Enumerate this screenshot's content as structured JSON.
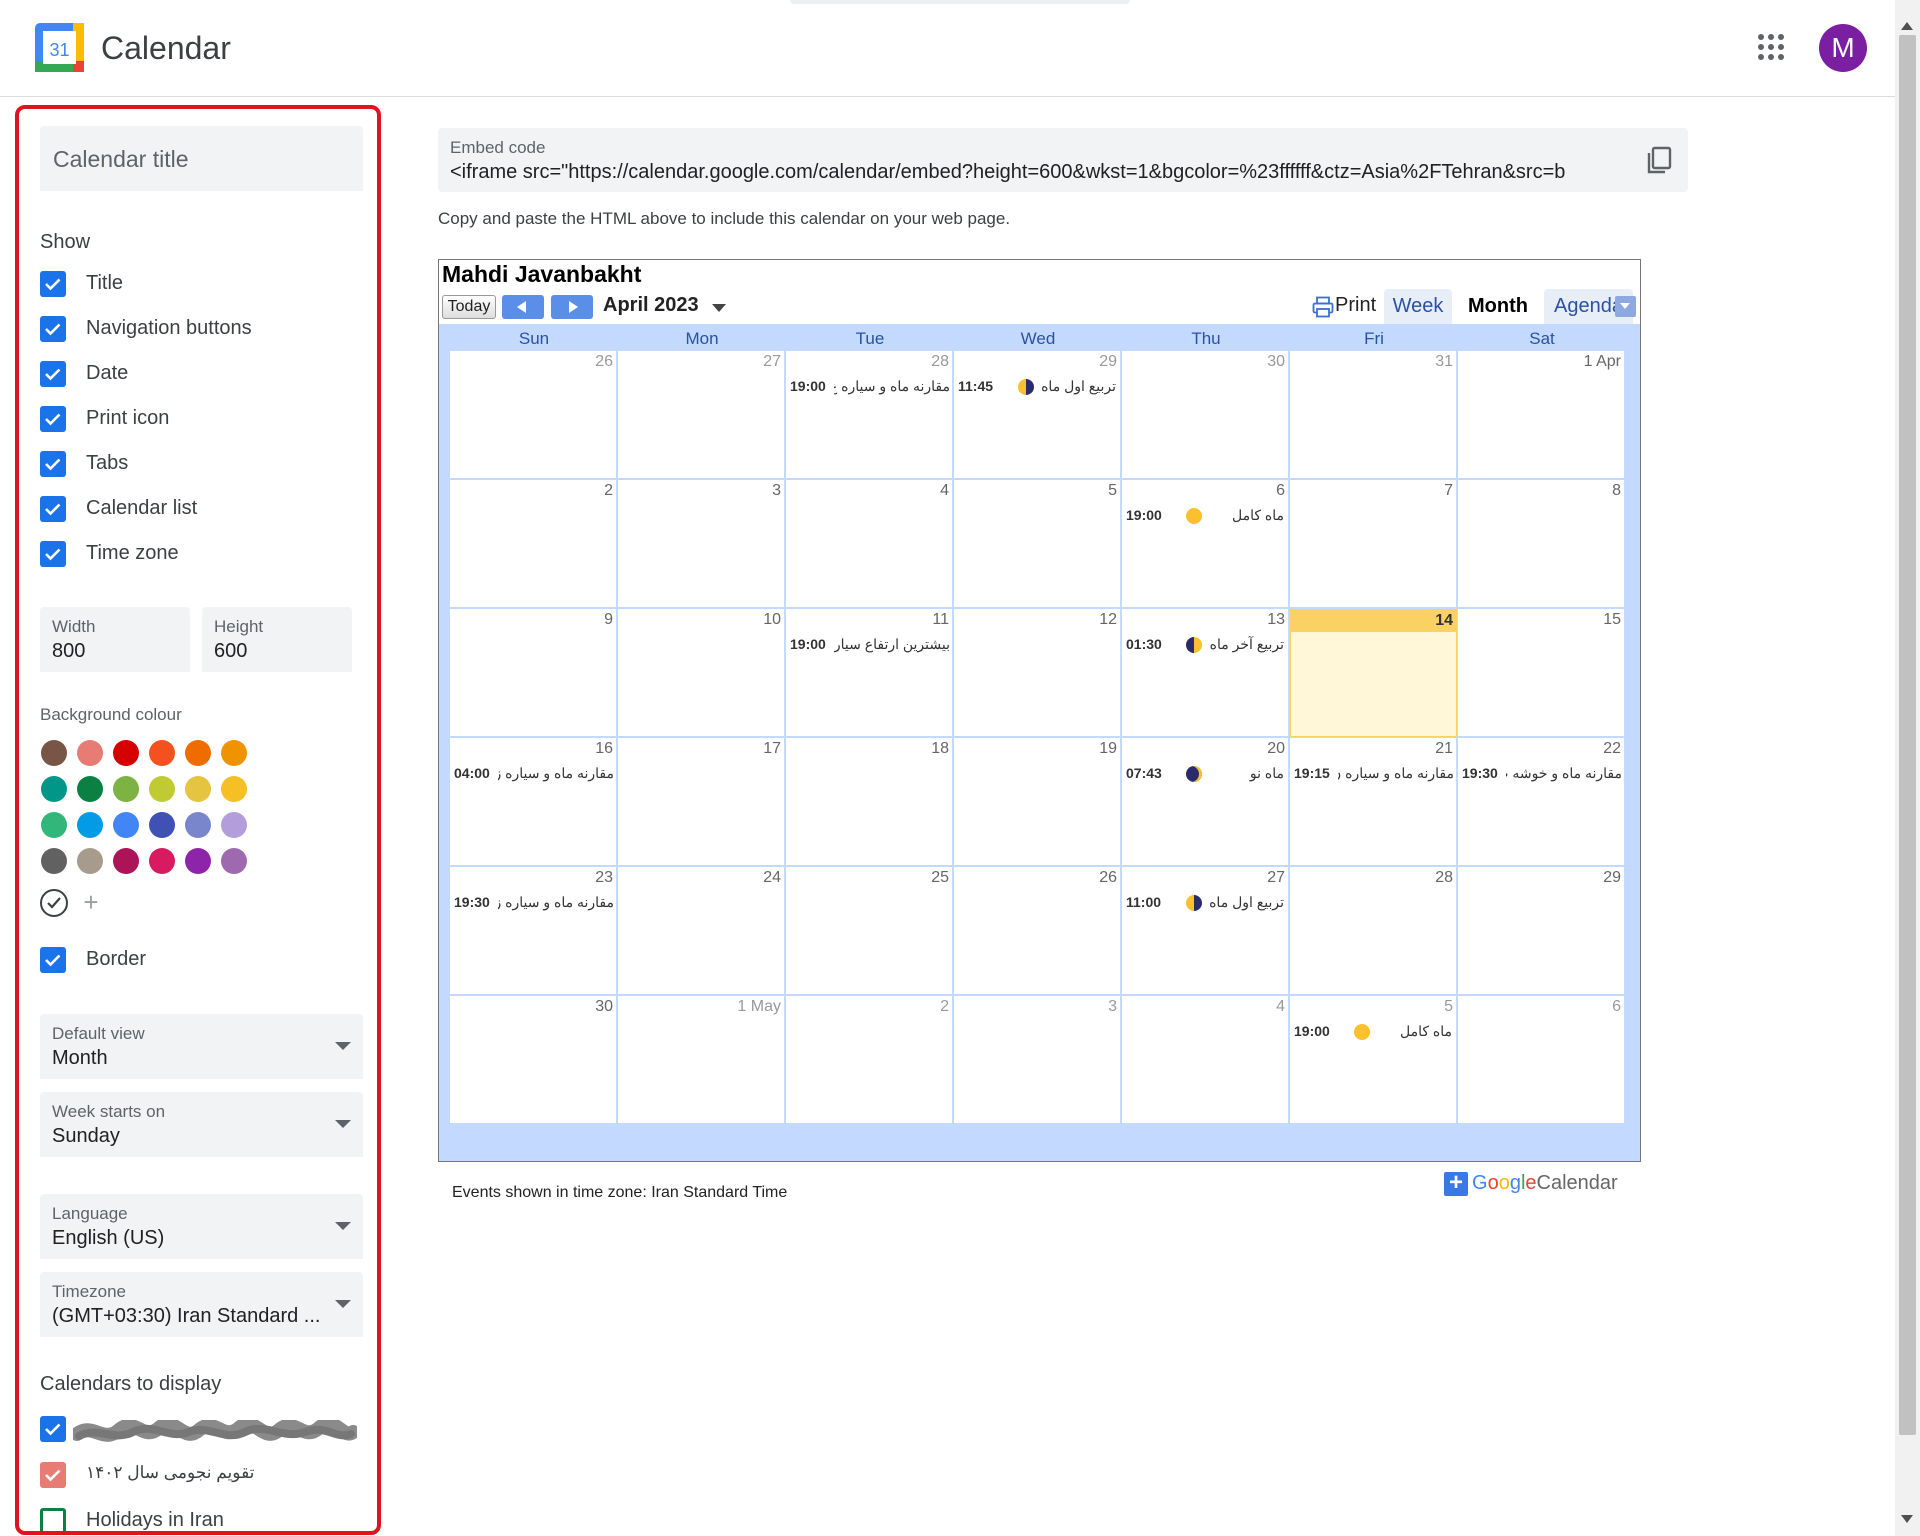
{
  "header": {
    "app_title": "Calendar",
    "logo_day": "31",
    "avatar_letter": "M"
  },
  "left_panel": {
    "calendar_title_placeholder": "Calendar title",
    "show_label": "Show",
    "show_options": [
      {
        "label": "Title",
        "checked": true
      },
      {
        "label": "Navigation buttons",
        "checked": true
      },
      {
        "label": "Date",
        "checked": true
      },
      {
        "label": "Print icon",
        "checked": true
      },
      {
        "label": "Tabs",
        "checked": true
      },
      {
        "label": "Calendar list",
        "checked": true
      },
      {
        "label": "Time zone",
        "checked": true
      }
    ],
    "width": {
      "label": "Width",
      "value": "800"
    },
    "height": {
      "label": "Height",
      "value": "600"
    },
    "background_label": "Background colour",
    "swatches": [
      "#795548",
      "#e67c73",
      "#d50000",
      "#f4511e",
      "#ef6c00",
      "#f09300",
      "#009688",
      "#0b8043",
      "#7cb342",
      "#c0ca33",
      "#e4c441",
      "#f6bf26",
      "#33b679",
      "#039be5",
      "#4285f4",
      "#3f51b5",
      "#7986cb",
      "#b39ddb",
      "#616161",
      "#a79b8e",
      "#ad1457",
      "#d81b60",
      "#8e24aa",
      "#9e69af"
    ],
    "border": {
      "label": "Border",
      "checked": true
    },
    "default_view": {
      "label": "Default view",
      "value": "Month"
    },
    "week_starts": {
      "label": "Week starts on",
      "value": "Sunday"
    },
    "language": {
      "label": "Language",
      "value": "English (US)"
    },
    "timezone": {
      "label": "Timezone",
      "value": "(GMT+03:30) Iran Standard ..."
    },
    "calendars_label": "Calendars to display",
    "calendars": [
      {
        "label": "",
        "checked": true,
        "redacted": true
      },
      {
        "label": "تقویم نجومی سال ۱۴۰۲",
        "checked": true,
        "color": "#e67c73"
      },
      {
        "label": "Holidays in Iran",
        "checked": false,
        "color": "#0b8043"
      }
    ]
  },
  "embed": {
    "label": "Embed code",
    "code": "<iframe src=\"https://calendar.google.com/calendar/embed?height=600&wkst=1&bgcolor=%23ffffff&ctz=Asia%2FTehran&src=b",
    "help": "Copy and paste the HTML above to include this calendar on your web page."
  },
  "calendar": {
    "title": "Mahdi Javanbakht",
    "today_label": "Today",
    "month_label": "April 2023",
    "print_label": "Print",
    "tabs": {
      "week": "Week",
      "month": "Month",
      "agenda": "Agenda"
    },
    "days_of_week": [
      "Sun",
      "Mon",
      "Tue",
      "Wed",
      "Thu",
      "Fri",
      "Sat"
    ],
    "weeks": [
      [
        {
          "d": "26",
          "other": true
        },
        {
          "d": "27",
          "other": true
        },
        {
          "d": "28",
          "other": true,
          "time": "19:00",
          "title": "مقارنه ماه و سیاره ع"
        },
        {
          "d": "29",
          "other": true,
          "time": "11:45",
          "title": "تربیع اول ماه",
          "moon": "half"
        },
        {
          "d": "30",
          "other": true
        },
        {
          "d": "31",
          "other": true
        },
        {
          "d": "1 Apr"
        }
      ],
      [
        {
          "d": "2"
        },
        {
          "d": "3"
        },
        {
          "d": "4"
        },
        {
          "d": "5"
        },
        {
          "d": "6",
          "time": "19:00",
          "title": "ماه کامل",
          "moon": "full"
        },
        {
          "d": "7"
        },
        {
          "d": "8"
        }
      ],
      [
        {
          "d": "9"
        },
        {
          "d": "10"
        },
        {
          "d": "11",
          "time": "19:00",
          "title": "بیشترین ارتفاع سیاره"
        },
        {
          "d": "12"
        },
        {
          "d": "13",
          "time": "01:30",
          "title": "تربیع آخر ماه",
          "moon": "half2"
        },
        {
          "d": "14",
          "today": true
        },
        {
          "d": "15"
        }
      ],
      [
        {
          "d": "16",
          "time": "04:00",
          "title": "مقارنه ماه و سیاره ز"
        },
        {
          "d": "17"
        },
        {
          "d": "18"
        },
        {
          "d": "19"
        },
        {
          "d": "20",
          "time": "07:43",
          "title": "ماه نو",
          "moon": "new"
        },
        {
          "d": "21",
          "time": "19:15",
          "title": "مقارنه ماه و سیاره ن"
        },
        {
          "d": "22",
          "time": "19:30",
          "title": "مقارنه ماه و خوشه پ"
        }
      ],
      [
        {
          "d": "23",
          "time": "19:30",
          "title": "مقارنه ماه و سیاره ز"
        },
        {
          "d": "24"
        },
        {
          "d": "25"
        },
        {
          "d": "26"
        },
        {
          "d": "27",
          "time": "11:00",
          "title": "تربیع اول ماه",
          "moon": "half"
        },
        {
          "d": "28"
        },
        {
          "d": "29"
        }
      ],
      [
        {
          "d": "30"
        },
        {
          "d": "1 May",
          "other": true
        },
        {
          "d": "2",
          "other": true
        },
        {
          "d": "3",
          "other": true
        },
        {
          "d": "4",
          "other": true
        },
        {
          "d": "5",
          "other": true,
          "time": "19:00",
          "title": "ماه کامل",
          "moon": "full"
        },
        {
          "d": "6",
          "other": true
        }
      ]
    ],
    "footer": "Events shown in time zone: Iran Standard Time",
    "badge": {
      "plus": "+",
      "google": "Google",
      "calendar": "Calendar"
    }
  }
}
